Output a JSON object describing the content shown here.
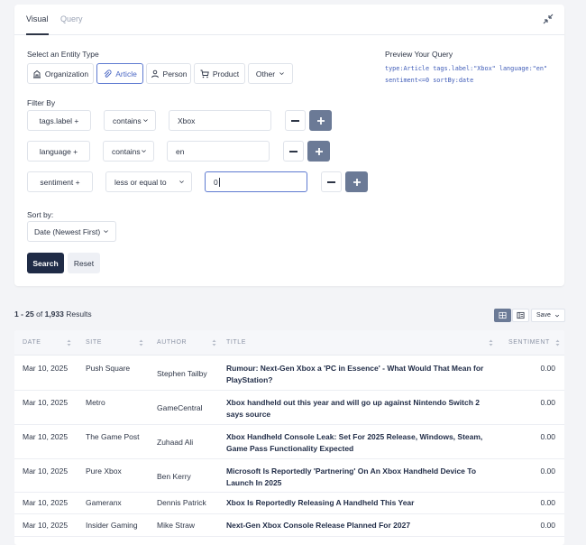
{
  "tabs": [
    {
      "label": "Visual"
    },
    {
      "label": "Query"
    }
  ],
  "entity": {
    "title": "Select an Entity Type",
    "types": [
      {
        "label": "Organization",
        "icon": "building-icon"
      },
      {
        "label": "Article",
        "icon": "paperclip-icon"
      },
      {
        "label": "Person",
        "icon": "person-icon"
      },
      {
        "label": "Product",
        "icon": "cart-icon"
      },
      {
        "label": "Other",
        "icon": "chevron-down-icon"
      }
    ],
    "selected": "Article"
  },
  "preview": {
    "title": "Preview Your Query",
    "line1": "type:Article tags.label:\"Xbox\" language:\"en\"",
    "line2": "sentiment<=0 sortBy:date"
  },
  "filter": {
    "title": "Filter By",
    "rows": [
      {
        "field": "tags.label +",
        "operator": "contains",
        "value": "Xbox"
      },
      {
        "field": "language +",
        "operator": "contains",
        "value": "en"
      },
      {
        "field": "sentiment +",
        "operator": "less or equal to",
        "value": "0"
      }
    ]
  },
  "sort": {
    "title": "Sort by:",
    "value": "Date (Newest First)"
  },
  "actions": {
    "search": "Search",
    "reset": "Reset"
  },
  "results": {
    "range": "1 - 25",
    "of": "of",
    "total": "1,933",
    "suffix": "Results",
    "save": "Save"
  },
  "table": {
    "headers": [
      "DATE",
      "SITE",
      "AUTHOR",
      "TITLE",
      "SENTIMENT"
    ],
    "rows": [
      {
        "date": "Mar 10, 2025",
        "site": "Push Square",
        "author": "Stephen Tailby",
        "title1": "Rumour: Next-Gen Xbox a 'PC in Essence' - What Would That Mean for",
        "title2": "PlayStation?",
        "sentiment": "0.00"
      },
      {
        "date": "Mar 10, 2025",
        "site": "Metro",
        "author": "GameCentral",
        "title1": "Xbox handheld out this year and will go up against Nintendo Switch 2",
        "title2": "says source",
        "sentiment": "0.00"
      },
      {
        "date": "Mar 10, 2025",
        "site": "The Game Post",
        "author": "Zuhaad Ali",
        "title1": "Xbox Handheld Console Leak: Set For 2025 Release, Windows, Steam,",
        "title2": "Game Pass Functionality Expected",
        "sentiment": "0.00"
      },
      {
        "date": "Mar 10, 2025",
        "site": "Pure Xbox",
        "author": "Ben Kerry",
        "title1": "Microsoft Is Reportedly 'Partnering' On An Xbox Handheld Device To",
        "title2": "Launch In 2025",
        "sentiment": "0.00"
      },
      {
        "date": "Mar 10, 2025",
        "site": "Gameranx",
        "author": "Dennis Patrick",
        "title1": "Xbox Is Reportedly Releasing A Handheld This Year",
        "title2": "",
        "sentiment": "0.00"
      },
      {
        "date": "Mar 10, 2025",
        "site": "Insider Gaming",
        "author": "Mike Straw",
        "title1": "Next-Gen Xbox Console Release Planned For 2027",
        "title2": "",
        "sentiment": "0.00"
      }
    ]
  }
}
